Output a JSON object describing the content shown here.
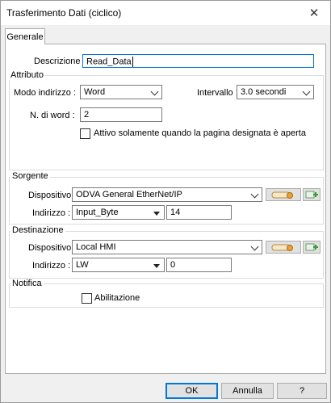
{
  "window": {
    "title": "Trasferimento Dati (ciclico)",
    "close_glyph": "✕"
  },
  "tabs": [
    {
      "label": "Generale"
    }
  ],
  "descrizione": {
    "label": "Descrizione :",
    "value": "Read_Data"
  },
  "attributo": {
    "title": "Attributo",
    "modo_label": "Modo indirizzo :",
    "modo_value": "Word",
    "intervallo_label": "Intervallo :",
    "intervallo_value": "3.0  secondi",
    "nword_label": "N. di word :",
    "nword_value": "2",
    "attivo_label": "Attivo solamente quando la pagina designata è aperta",
    "attivo_checked": false
  },
  "sorgente": {
    "title": "Sorgente",
    "dispositivo_label": "Dispositivo :",
    "dispositivo_value": "ODVA General EtherNet/IP",
    "indirizzo_label": "Indirizzo :",
    "indirizzo_type": "Input_Byte",
    "indirizzo_value": "14"
  },
  "destinazione": {
    "title": "Destinazione",
    "dispositivo_label": "Dispositivo :",
    "dispositivo_value": "Local HMI",
    "indirizzo_label": "Indirizzo :",
    "indirizzo_type": "LW",
    "indirizzo_value": "0"
  },
  "notifica": {
    "title": "Notifica",
    "abilitazione_label": "Abilitazione",
    "abilitazione_checked": false
  },
  "buttons": {
    "ok": "OK",
    "annulla": "Annulla",
    "help": "?"
  },
  "colors": {
    "accent": "#0078d7",
    "icon_orange": "#e8a23a",
    "icon_green": "#3a9a3a"
  }
}
